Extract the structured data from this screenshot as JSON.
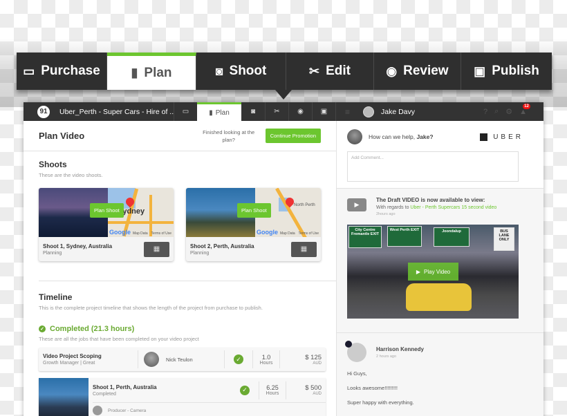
{
  "steps": [
    {
      "label": "Purchase",
      "icon": "credit-card-icon",
      "glyph": "▭",
      "active": false
    },
    {
      "label": "Plan",
      "icon": "document-icon",
      "glyph": "▮",
      "active": true
    },
    {
      "label": "Shoot",
      "icon": "camera-icon",
      "glyph": "◙",
      "active": false
    },
    {
      "label": "Edit",
      "icon": "scissors-icon",
      "glyph": "✂",
      "active": false
    },
    {
      "label": "Review",
      "icon": "eye-icon",
      "glyph": "◉",
      "active": false
    },
    {
      "label": "Publish",
      "icon": "youtube-icon",
      "glyph": "▣",
      "active": false
    }
  ],
  "topbar": {
    "logo": "91",
    "project_title": "Uber_Perth - Super Cars - Hire of ...",
    "plan_tab": "Plan",
    "user_name": "Jake Davy",
    "notification_count": "12"
  },
  "plan": {
    "title": "Plan Video",
    "finished_text": "Finished looking at the plan?",
    "continue_label": "Continue Promotion"
  },
  "shoots": {
    "title": "Shoots",
    "subtitle": "These are the video shoots.",
    "items": [
      {
        "name": "Shoot 1, Sydney, Australia",
        "status": "Planning",
        "button": "Plan Shoot",
        "map_label": "Sydney",
        "map_data": "Map Data",
        "terms": "Terms of Use"
      },
      {
        "name": "Shoot 2, Perth, Australia",
        "status": "Planning",
        "button": "Plan Shoot",
        "map_label": "North Perth",
        "map_data": "Map Data",
        "terms": "Terms of Use"
      }
    ]
  },
  "timeline": {
    "title": "Timeline",
    "subtitle": "This is the complete project timeline that shows the length of the project from purchase to publish.",
    "completed_label": "Completed (21.3 hours)",
    "completed_sub": "These are all the jobs that have been completed on your video project",
    "jobs": [
      {
        "title": "Video Project Scoping",
        "sub": "Growth Manager | Great",
        "person": "Nick Teulon",
        "hours": "1.0",
        "hours_label": "Hours",
        "price": "$ 125",
        "currency": "AUD"
      },
      {
        "title": "Shoot 1, Perth, Australia",
        "sub": "Completed",
        "hours": "6.25",
        "hours_label": "Hours",
        "price": "$ 500",
        "currency": "AUD",
        "role": "Producer - Camera"
      }
    ]
  },
  "sidebar": {
    "help_prefix": "How can we help, ",
    "help_name": "Jake?",
    "brand": "UBER",
    "comment_placeholder": "Add Comment...",
    "draft_title": "The Draft VIDEO is now available to view:",
    "draft_prefix": "With regards to ",
    "draft_link": "Uber - Perth Supercars 15 second video",
    "draft_time": "2hours ago",
    "play_label": "Play Video",
    "signs": [
      "City Centre Fremantle EXIT",
      "West Perth EXIT",
      "Joondalup",
      "BUS LANE ONLY"
    ],
    "comment": {
      "name": "Harrison Kennedy",
      "time": "2 hours ago",
      "lines": [
        "Hi Guys,",
        "Looks awesome!!!!!!!!!",
        "Super happy with everything."
      ]
    }
  },
  "colors": {
    "accent": "#6cc62f",
    "dark": "#2f2f2f",
    "badge": "#e11111"
  }
}
